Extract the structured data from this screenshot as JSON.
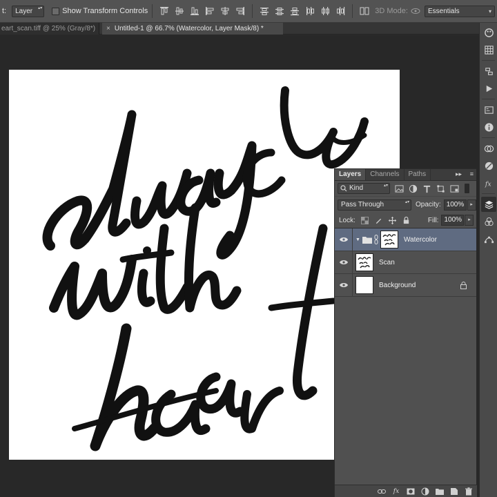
{
  "options_bar": {
    "auto_select_label": "t:",
    "auto_select_value": "Layer",
    "show_transform_label": "Show Transform Controls",
    "mode_label": "3D Mode:",
    "workspace_value": "Essentials"
  },
  "tabs": [
    {
      "label": "eart_scan.tiff @ 25% (Gray/8*)",
      "active": false
    },
    {
      "label": "Untitled-1 @ 66.7% (Watercolor, Layer Mask/8) *",
      "active": true
    }
  ],
  "artwork": {
    "lines": [
      "always",
      "with",
      "heart"
    ]
  },
  "layers_panel": {
    "tabs": [
      "Layers",
      "Channels",
      "Paths"
    ],
    "collapse_glyph": "▸▸",
    "menu_glyph": "≡",
    "kind_label": "Kind",
    "blend_mode": "Pass Through",
    "opacity_label": "Opacity:",
    "opacity_value": "100%",
    "lock_label": "Lock:",
    "fill_label": "Fill:",
    "fill_value": "100%",
    "layers": [
      {
        "name": "Watercolor",
        "type": "group",
        "selected": true,
        "visible": true
      },
      {
        "name": "Scan",
        "type": "pixel",
        "selected": false,
        "visible": true
      },
      {
        "name": "Background",
        "type": "background",
        "selected": false,
        "visible": true,
        "locked": true
      }
    ],
    "footer_glyphs": {
      "fx": "fx"
    }
  },
  "colors": {
    "selection": "#5f6b81",
    "panel_bg": "#505050",
    "app_bg": "#282828"
  }
}
